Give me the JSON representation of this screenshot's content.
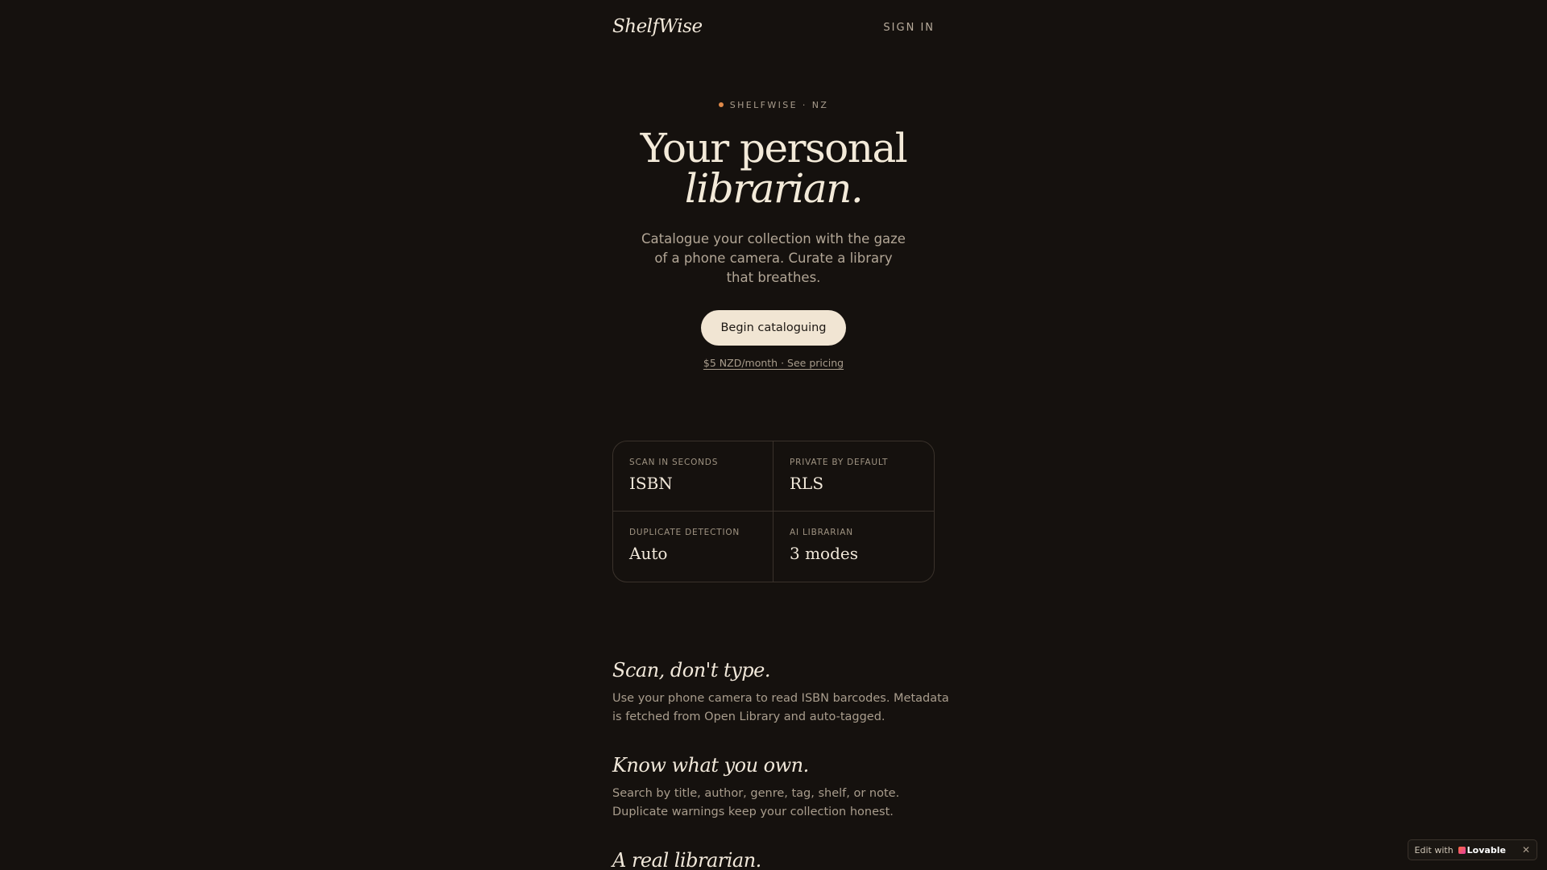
{
  "header": {
    "logo": "ShelfWise",
    "signin": "SIGN IN"
  },
  "hero": {
    "eyebrow": "SHELFWISE · NZ",
    "headline_line1": "Your personal",
    "headline_line2": "librarian.",
    "subtitle": "Catalogue your collection with the gaze of a phone camera. Curate a library that breathes.",
    "cta": "Begin cataloguing",
    "pricing_link": "$5 NZD/month · See pricing"
  },
  "stats": [
    {
      "label": "SCAN IN SECONDS",
      "value": "ISBN"
    },
    {
      "label": "PRIVATE BY DEFAULT",
      "value": "RLS"
    },
    {
      "label": "DUPLICATE DETECTION",
      "value": "Auto"
    },
    {
      "label": "AI LIBRARIAN",
      "value": "3 modes"
    }
  ],
  "features": [
    {
      "title": "Scan, don't type.",
      "body": "Use your phone camera to read ISBN barcodes. Metadata is fetched from Open Library and auto-tagged."
    },
    {
      "title": "Know what you own.",
      "body": "Search by title, author, genre, tag, shelf, or note. Duplicate warnings keep your collection honest."
    },
    {
      "title": "A real librarian.",
      "body": ""
    }
  ],
  "badge": {
    "prefix": "Edit with",
    "brand": "Lovable",
    "close": "✕"
  },
  "colors": {
    "background": "#15110e",
    "accent_dot": "#e08a4a",
    "cta_background": "#f1e5d3"
  }
}
